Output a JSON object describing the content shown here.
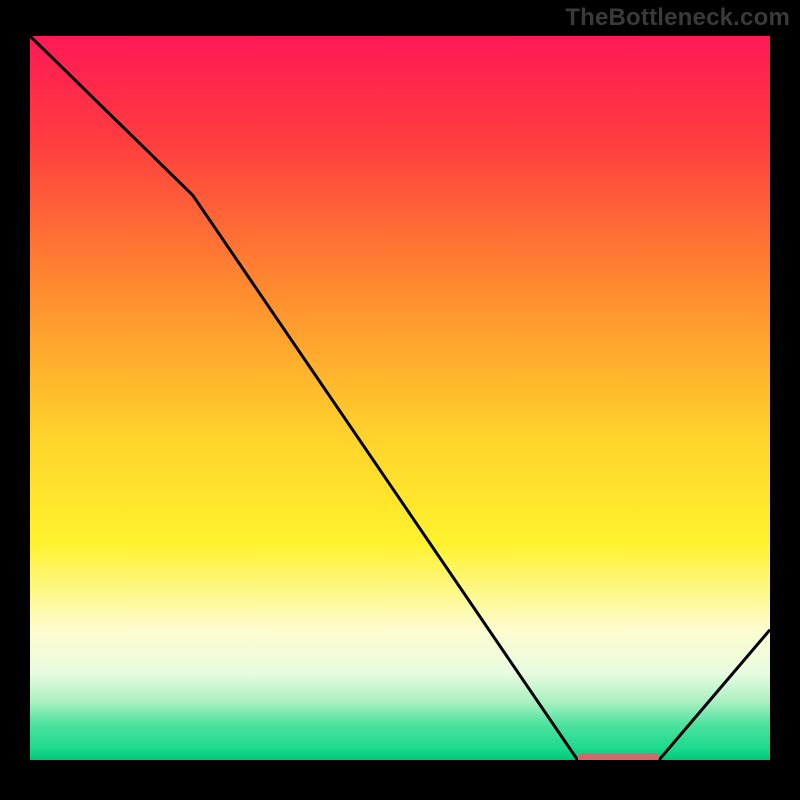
{
  "attribution_text": "TheBottleneck.com",
  "chart_data": {
    "type": "line",
    "title": "",
    "xlabel": "",
    "ylabel": "",
    "xlim": [
      0,
      100
    ],
    "ylim": [
      0,
      100
    ],
    "x": [
      0,
      22,
      74,
      85,
      100
    ],
    "values": [
      100,
      78,
      0,
      0,
      18
    ],
    "marker": {
      "x_start": 74,
      "x_end": 85,
      "y": 0,
      "color": "#d06a6a"
    },
    "background_gradient_stops": [
      {
        "pct": 0,
        "color": "#ff1956"
      },
      {
        "pct": 14,
        "color": "#ff3b3f"
      },
      {
        "pct": 35,
        "color": "#ff8b2f"
      },
      {
        "pct": 55,
        "color": "#ffd22b"
      },
      {
        "pct": 70,
        "color": "#fff22d"
      },
      {
        "pct": 82,
        "color": "#fdfccf"
      },
      {
        "pct": 88,
        "color": "#e8fce0"
      },
      {
        "pct": 92,
        "color": "#a9f0c0"
      },
      {
        "pct": 95,
        "color": "#4fe3a0"
      },
      {
        "pct": 98.5,
        "color": "#1ad98d"
      },
      {
        "pct": 100,
        "color": "#00c877"
      }
    ],
    "line_color": "#000000",
    "line_width": 3
  }
}
